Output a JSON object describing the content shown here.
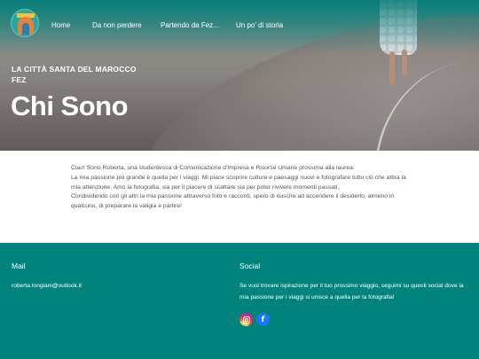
{
  "nav": {
    "items": [
      {
        "label": "Home"
      },
      {
        "label": "Da non perdere"
      },
      {
        "label": "Partendo da Fez..."
      },
      {
        "label": "Un po' di storia"
      }
    ]
  },
  "hero": {
    "kicker_line1": "LA CITTÀ SANTA DEL MAROCCO",
    "kicker_line2": "FEZ",
    "title": "Chi Sono"
  },
  "content": {
    "paragraphs": [
      "Ciao! Sono Roberta, una studentessa di Comunicazione d'Impresa e Risorse Umane prossima alla laurea.",
      "La mia passione più grande è quella per i viaggi. Mi piace scoprire culture e paesaggi nuovi e fotografare tutto ciò che attira la mia attenzione. Amo la fotografia, sia per il piacere di scattare sia per poter rivivere momenti passati.",
      "Condividendo con gli altri la mia passione attraverso foto e racconti, spero di riuscire ad accendere il desiderio, almeno in qualcuno, di preparare la valigia e partire!"
    ]
  },
  "footer": {
    "mail_heading": "Mail",
    "mail_address": "roberta.tongiani@outlook.it",
    "social_heading": "Social",
    "social_text": "Se vuoi trovare ispirazione per il tuo prossimo viaggio, seguimi su questi social dove la mia passione per i viaggi si unisce a quella per la fotografia!",
    "icons": [
      "instagram-icon",
      "facebook-icon"
    ]
  },
  "colors": {
    "teal": "#00837d",
    "text": "#555555"
  }
}
